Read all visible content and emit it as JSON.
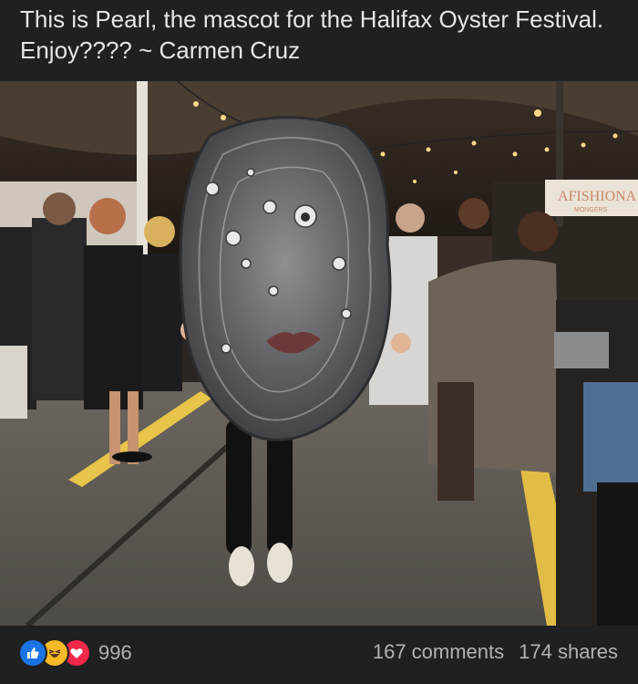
{
  "post": {
    "caption": "This is Pearl, the mascot for the Halifax Oyster Festival. Enjoy???? ~ Carmen Cruz"
  },
  "photo": {
    "sign_text": "AFISHIONA",
    "sign_subtext": "MONGERS"
  },
  "footer": {
    "reactions": [
      "like-icon",
      "haha-icon",
      "love-icon"
    ],
    "reaction_count": "996",
    "comments": "167 comments",
    "shares": "174 shares"
  },
  "colors": {
    "background": "#18191a",
    "bar": "#1f2021",
    "text": "#e4e6eb",
    "muted": "#b0b3b8",
    "like": "#1b74e4",
    "haha": "#f7b928",
    "love": "#f0284a"
  }
}
